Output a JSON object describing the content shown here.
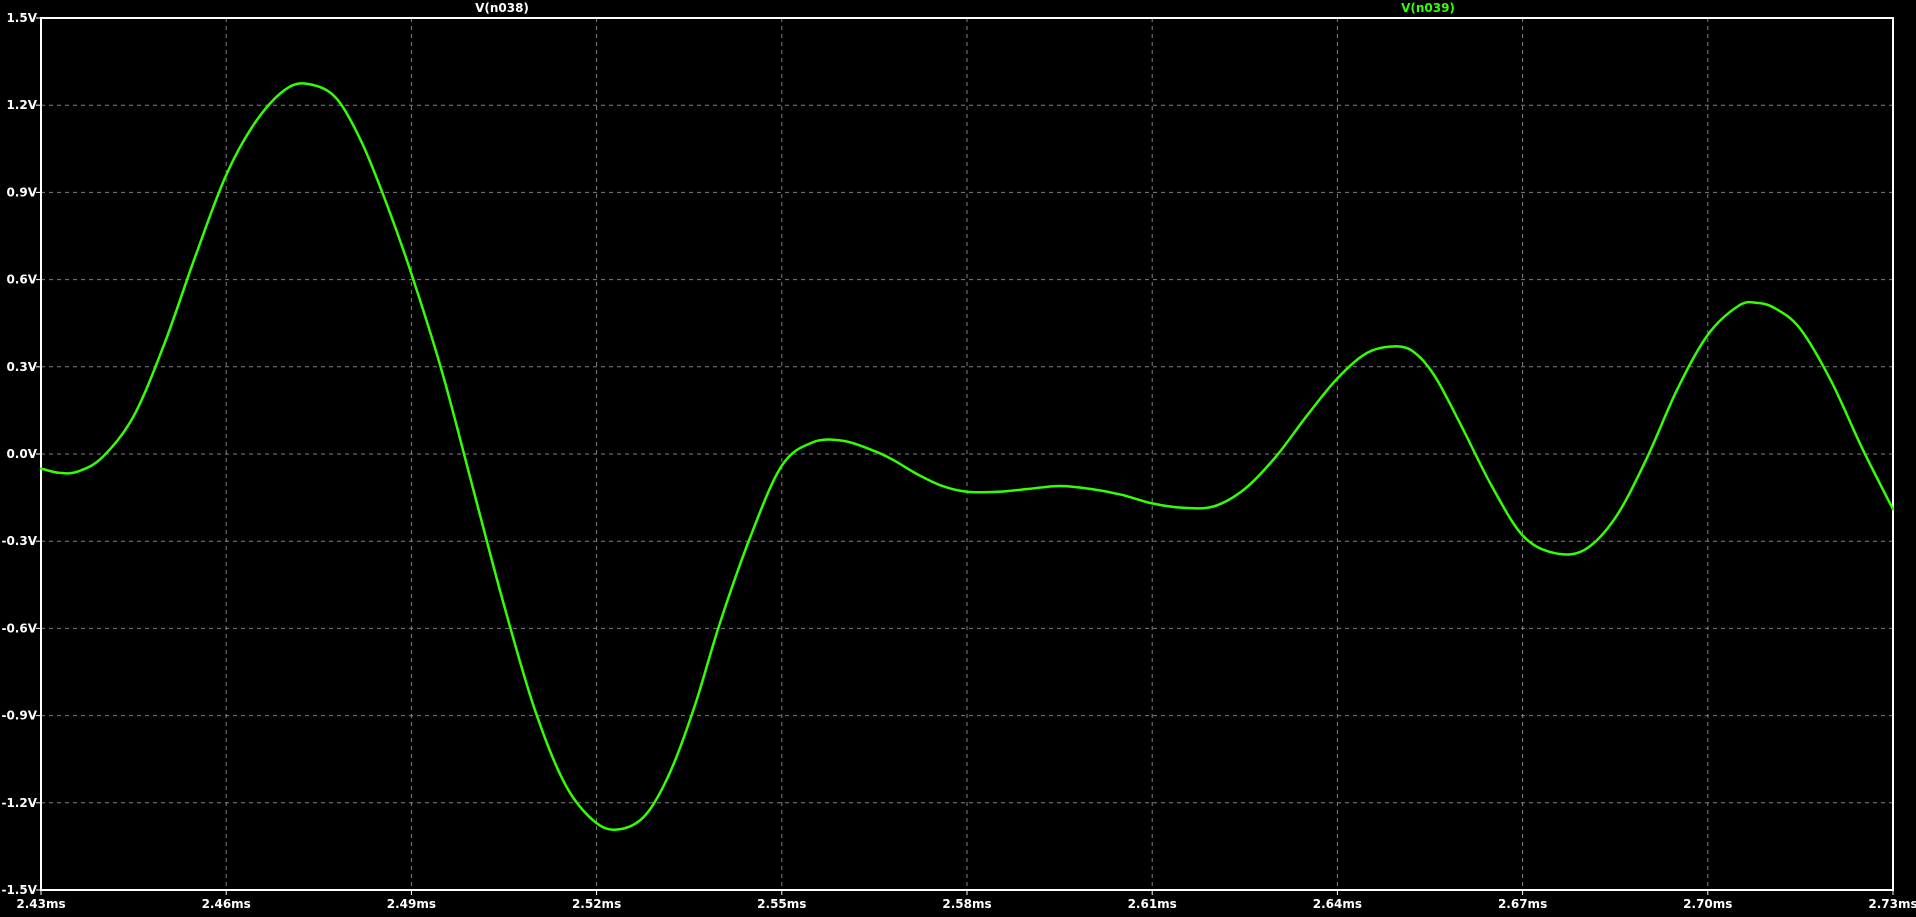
{
  "chart_data": {
    "type": "line",
    "title": "",
    "xlabel": "",
    "ylabel": "",
    "xlim": [
      2.43,
      2.73
    ],
    "ylim": [
      -1.5,
      1.5
    ],
    "grid": true,
    "legend_position": "top",
    "x_ticks": [
      2.43,
      2.46,
      2.49,
      2.52,
      2.55,
      2.58,
      2.61,
      2.64,
      2.67,
      2.7,
      2.73
    ],
    "x_tick_labels": [
      "2.43ms",
      "2.46ms",
      "2.49ms",
      "2.52ms",
      "2.55ms",
      "2.58ms",
      "2.61ms",
      "2.64ms",
      "2.67ms",
      "2.70ms",
      "2.73ms"
    ],
    "y_ticks": [
      1.5,
      1.2,
      0.9,
      0.6,
      0.3,
      0.0,
      -0.3,
      -0.6,
      -0.9,
      -1.2,
      -1.5
    ],
    "y_tick_labels": [
      "1.5V",
      "1.2V",
      "0.9V",
      "0.6V",
      "0.3V",
      "0.0V",
      "-0.3V",
      "-0.6V",
      "-0.9V",
      "-1.2V",
      "-1.5V"
    ],
    "legend": [
      {
        "name": "V(n038)",
        "color": "#ffffff"
      },
      {
        "name": "V(n039)",
        "color": "#33ff00"
      }
    ],
    "series": [
      {
        "name": "V(n039)",
        "color": "#33ff00",
        "x": [
          2.43,
          2.433,
          2.436,
          2.44,
          2.445,
          2.45,
          2.455,
          2.46,
          2.465,
          2.47,
          2.474,
          2.478,
          2.482,
          2.486,
          2.49,
          2.495,
          2.5,
          2.505,
          2.51,
          2.515,
          2.52,
          2.524,
          2.528,
          2.532,
          2.536,
          2.54,
          2.545,
          2.55,
          2.555,
          2.56,
          2.565,
          2.568,
          2.572,
          2.576,
          2.58,
          2.585,
          2.59,
          2.595,
          2.6,
          2.605,
          2.61,
          2.615,
          2.62,
          2.625,
          2.63,
          2.635,
          2.64,
          2.645,
          2.65,
          2.653,
          2.656,
          2.66,
          2.665,
          2.67,
          2.675,
          2.68,
          2.685,
          2.69,
          2.695,
          2.7,
          2.705,
          2.708,
          2.711,
          2.715,
          2.72,
          2.725,
          2.73
        ],
        "y": [
          -0.05,
          -0.065,
          -0.06,
          -0.01,
          0.13,
          0.38,
          0.68,
          0.96,
          1.15,
          1.26,
          1.27,
          1.22,
          1.07,
          0.86,
          0.62,
          0.28,
          -0.12,
          -0.52,
          -0.88,
          -1.14,
          -1.27,
          -1.29,
          -1.24,
          -1.09,
          -0.86,
          -0.58,
          -0.28,
          -0.04,
          0.04,
          0.045,
          0.01,
          -0.02,
          -0.07,
          -0.11,
          -0.13,
          -0.13,
          -0.12,
          -0.11,
          -0.12,
          -0.14,
          -0.17,
          -0.185,
          -0.18,
          -0.12,
          -0.01,
          0.13,
          0.26,
          0.35,
          0.37,
          0.34,
          0.26,
          0.1,
          -0.11,
          -0.28,
          -0.34,
          -0.33,
          -0.22,
          -0.02,
          0.22,
          0.41,
          0.51,
          0.52,
          0.5,
          0.43,
          0.25,
          0.02,
          -0.19
        ]
      }
    ]
  }
}
